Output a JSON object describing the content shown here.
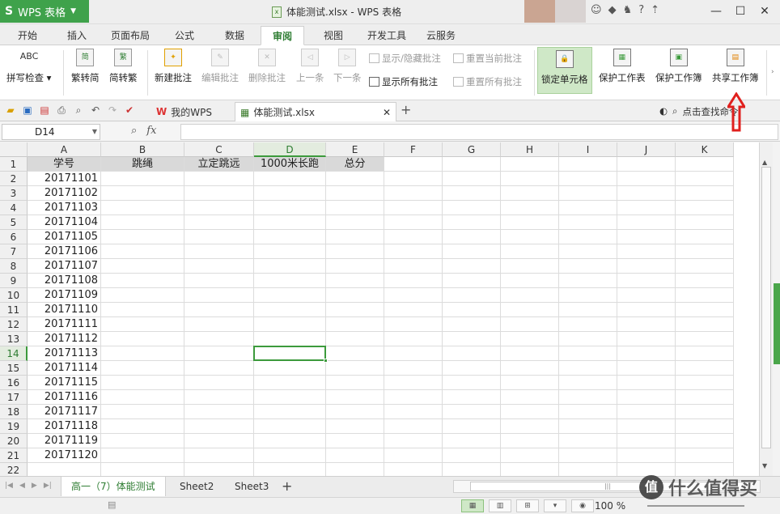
{
  "app": {
    "name": "WPS 表格",
    "logo": "S"
  },
  "window": {
    "title": "体能测试.xlsx - WPS 表格"
  },
  "ribbon_tabs": [
    "开始",
    "插入",
    "页面布局",
    "公式",
    "数据",
    "审阅",
    "视图",
    "开发工具",
    "云服务"
  ],
  "active_tab": "审阅",
  "ribbon": {
    "spellcheck": "拼写检查",
    "spellcheck_icon": "ABC",
    "to_traditional": "繁转简",
    "to_simplified": "简转繁",
    "new_comment": "新建批注",
    "edit_comment": "编辑批注",
    "delete_comment": "删除批注",
    "prev": "上一条",
    "next": "下一条",
    "show_hide_comment": "显示/隐藏批注",
    "reset_current_comment": "重置当前批注",
    "show_all_comments": "显示所有批注",
    "reset_all_comments": "重置所有批注",
    "lock_cell": "锁定单元格",
    "protect_sheet": "保护工作表",
    "protect_workbook": "保护工作簿",
    "share_workbook": "共享工作簿"
  },
  "doc_tabs": {
    "home": "我的WPS",
    "current": "体能测试.xlsx"
  },
  "search_label": "点击查找命令",
  "formula_bar": {
    "name_box": "D14",
    "fx": "fx",
    "value": ""
  },
  "columns": [
    "A",
    "B",
    "C",
    "D",
    "E",
    "F",
    "G",
    "H",
    "I",
    "J",
    "K"
  ],
  "rows": [
    "1",
    "2",
    "3",
    "4",
    "5",
    "6",
    "7",
    "8",
    "9",
    "10",
    "11",
    "12",
    "13",
    "14",
    "15",
    "16",
    "17",
    "18",
    "19",
    "20",
    "21",
    "22"
  ],
  "header_row": [
    "学号",
    "跳绳",
    "立定跳远",
    "1000米长跑",
    "总分"
  ],
  "student_ids": [
    "20171101",
    "20171102",
    "20171103",
    "20171104",
    "20171105",
    "20171106",
    "20171107",
    "20171108",
    "20171109",
    "20171110",
    "20171111",
    "20171112",
    "20171113",
    "20171114",
    "20171115",
    "20171116",
    "20171117",
    "20171118",
    "20171119",
    "20171120"
  ],
  "selected_cell": "D14",
  "sheets": [
    "高一（7）体能测试",
    "Sheet2",
    "Sheet3"
  ],
  "active_sheet": "高一（7）体能测试",
  "zoom": "100 %",
  "watermark": "什么值得买",
  "colors": {
    "accent": "#3fa24b",
    "selection": "#3c9a3c",
    "header_fill": "#d9d9d9",
    "annotation": "#e0201e"
  }
}
